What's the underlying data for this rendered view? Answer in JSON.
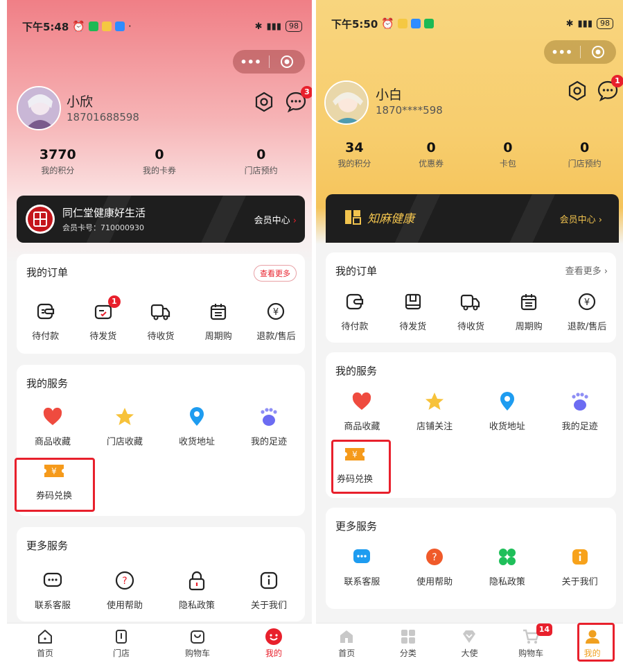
{
  "left": {
    "status": {
      "time": "下午5:48",
      "battery": "98"
    },
    "user": {
      "name": "小欣",
      "phone": "18701688598",
      "message_badge": "3"
    },
    "stats": [
      {
        "num": "3770",
        "label": "我的积分"
      },
      {
        "num": "0",
        "label": "我的卡券"
      },
      {
        "num": "0",
        "label": "门店预约"
      }
    ],
    "member": {
      "title": "同仁堂健康好生活",
      "card_no": "会员卡号：710000930",
      "center": "会员中心"
    },
    "orders": {
      "title": "我的订单",
      "more": "查看更多",
      "items": [
        {
          "label": "待付款"
        },
        {
          "label": "待发货",
          "badge": "1"
        },
        {
          "label": "待收货"
        },
        {
          "label": "周期购"
        },
        {
          "label": "退款/售后"
        }
      ]
    },
    "services": {
      "title": "我的服务",
      "items": [
        {
          "label": "商品收藏"
        },
        {
          "label": "门店收藏"
        },
        {
          "label": "收货地址"
        },
        {
          "label": "我的足迹"
        },
        {
          "label": "券码兑换"
        }
      ]
    },
    "more_services": {
      "title": "更多服务",
      "items": [
        {
          "label": "联系客服"
        },
        {
          "label": "使用帮助"
        },
        {
          "label": "隐私政策"
        },
        {
          "label": "关于我们"
        }
      ]
    },
    "tabs": [
      {
        "label": "首页"
      },
      {
        "label": "门店"
      },
      {
        "label": "购物车"
      },
      {
        "label": "我的"
      }
    ],
    "colors": {
      "accent": "#e8202c"
    }
  },
  "right": {
    "status": {
      "time": "下午5:50",
      "battery": "98"
    },
    "user": {
      "name": "小白",
      "phone": "1870****598",
      "message_badge": "1"
    },
    "stats": [
      {
        "num": "34",
        "label": "我的积分"
      },
      {
        "num": "0",
        "label": "优惠券"
      },
      {
        "num": "0",
        "label": "卡包"
      },
      {
        "num": "0",
        "label": "门店预约"
      }
    ],
    "member": {
      "brand": "知麻健康",
      "center": "会员中心"
    },
    "orders": {
      "title": "我的订单",
      "more": "查看更多",
      "items": [
        {
          "label": "待付款"
        },
        {
          "label": "待发货"
        },
        {
          "label": "待收货"
        },
        {
          "label": "周期购"
        },
        {
          "label": "退款/售后"
        }
      ]
    },
    "services": {
      "title": "我的服务",
      "items": [
        {
          "label": "商品收藏"
        },
        {
          "label": "店铺关注"
        },
        {
          "label": "收货地址"
        },
        {
          "label": "我的足迹"
        },
        {
          "label": "券码兑换"
        }
      ]
    },
    "more_services": {
      "title": "更多服务",
      "items": [
        {
          "label": "联系客服"
        },
        {
          "label": "使用帮助"
        },
        {
          "label": "隐私政策"
        },
        {
          "label": "关于我们"
        }
      ]
    },
    "tabs": [
      {
        "label": "首页"
      },
      {
        "label": "分类"
      },
      {
        "label": "大使"
      },
      {
        "label": "购物车",
        "badge": "14"
      },
      {
        "label": "我的"
      }
    ],
    "colors": {
      "accent": "#f0a020"
    }
  }
}
